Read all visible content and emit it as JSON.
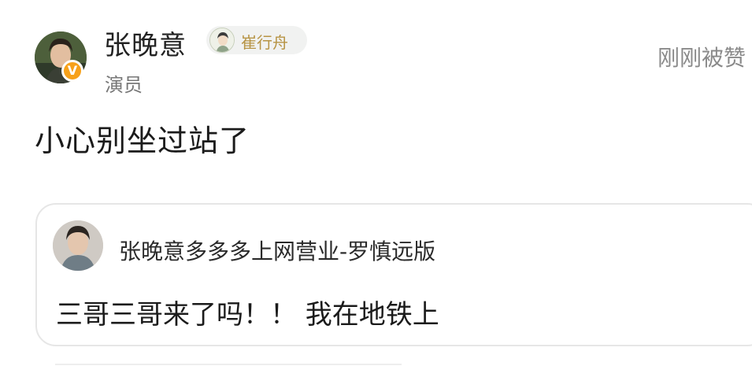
{
  "author": {
    "name": "张晚意",
    "badge_label": "崔行舟",
    "title": "演员",
    "verified_mark": "V"
  },
  "status": "刚刚被赞",
  "comment_text": "小心别坐过站了",
  "quoted": {
    "name": "张晚意多多多上网营业-罗慎远版",
    "text": "三哥三哥来了吗！！ 我在地铁上"
  },
  "colors": {
    "verified": "#f7a11a",
    "badge_text": "#b79445",
    "muted": "#8a8a8a"
  }
}
